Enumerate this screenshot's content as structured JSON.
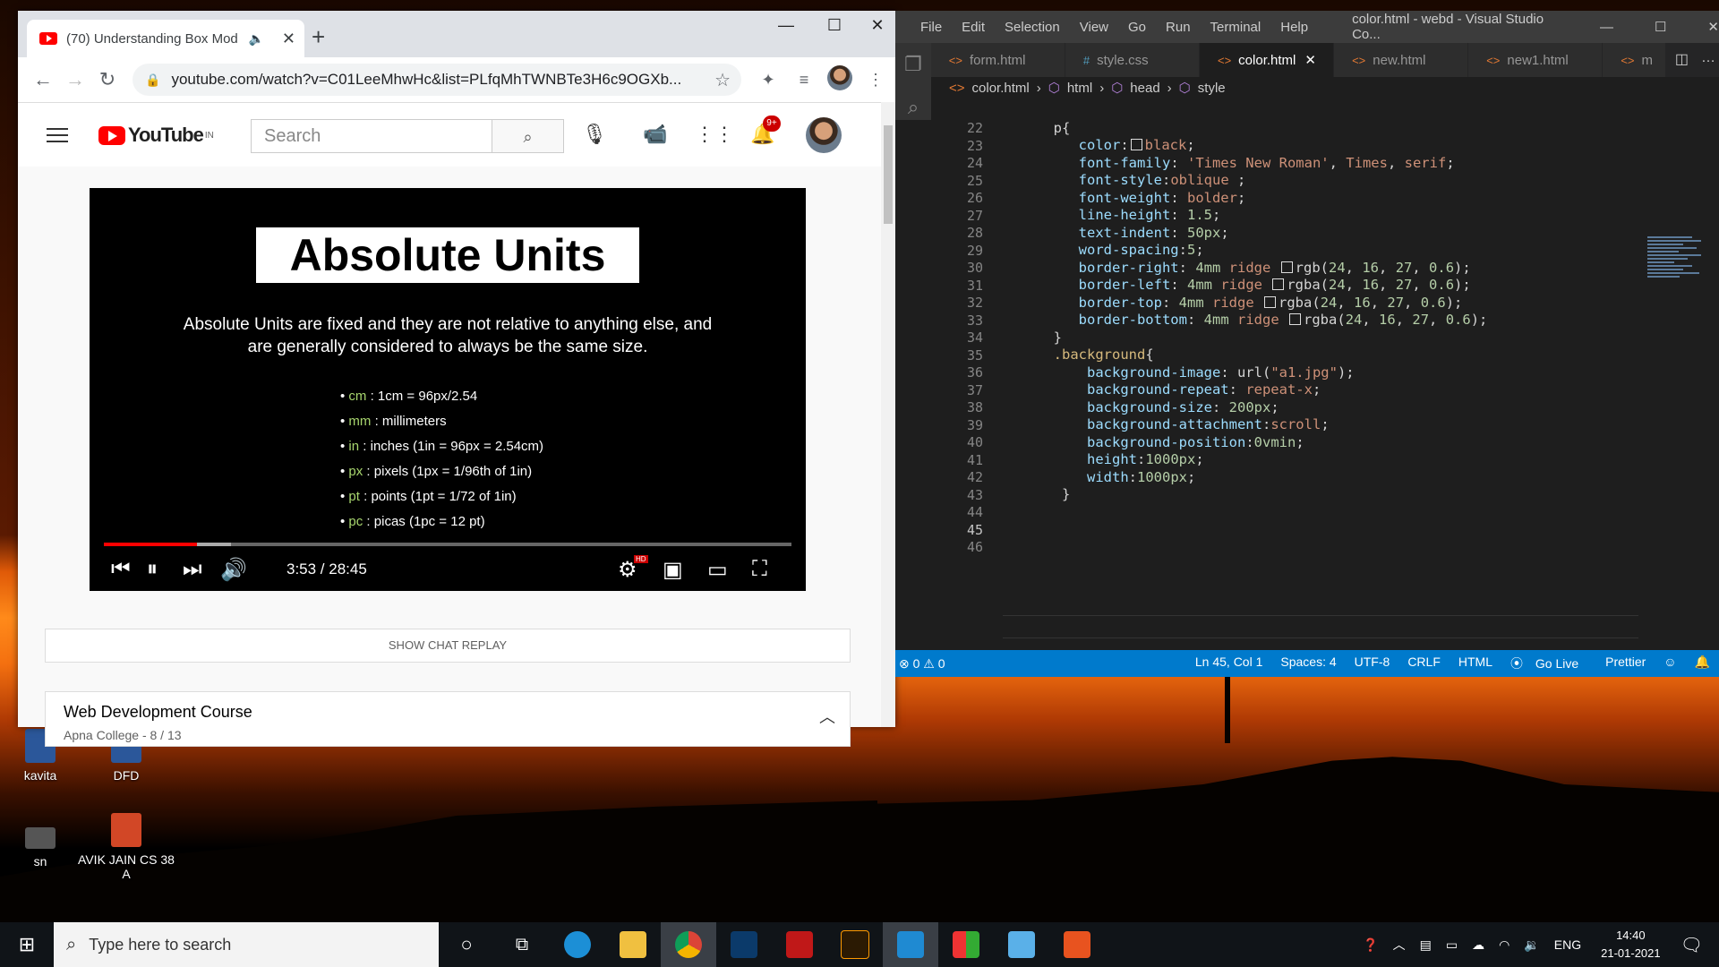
{
  "desktop": {
    "icons": [
      {
        "label": "kavita",
        "type": "word"
      },
      {
        "label": "DFD",
        "type": "word"
      },
      {
        "label": "sn",
        "type": "image"
      },
      {
        "label": "AVIK JAIN CS 38 A",
        "type": "powerpoint"
      }
    ]
  },
  "chrome": {
    "tab_title": "(70) Understanding Box Mod",
    "url": "youtube.com/watch?v=C01LeeMhwHc&list=PLfqMhTWNBTe3H6c9OGXb..."
  },
  "youtube": {
    "logo_text": "YouTube",
    "logo_region": "IN",
    "search_placeholder": "Search",
    "notifications_badge": "9+",
    "slide": {
      "title": "Absolute Units",
      "description": "Absolute Units are fixed and they are not relative to anything else, and are generally considered to always be the same size.",
      "bullets": [
        {
          "key": "cm",
          "text": " : 1cm = 96px/2.54"
        },
        {
          "key": "mm",
          "text": " : millimeters"
        },
        {
          "key": "in",
          "text": " : inches (1in = 96px = 2.54cm)"
        },
        {
          "key": "px",
          "text": " : pixels (1px = 1/96th of 1in)"
        },
        {
          "key": "pt",
          "text": " : points (1pt = 1/72 of 1in)"
        },
        {
          "key": "pc",
          "text": " : picas (1pc = 12 pt)"
        }
      ]
    },
    "player": {
      "time": "3:53 / 28:45",
      "played_fraction": 0.135,
      "buffered_fraction": 0.185,
      "quality_badge": "HD"
    },
    "chat_replay": "SHOW CHAT REPLAY",
    "playlist": {
      "title": "Web Development Course",
      "subtitle": "Apna College - 8 / 13"
    }
  },
  "vscode": {
    "menu": [
      "File",
      "Edit",
      "Selection",
      "View",
      "Go",
      "Run",
      "Terminal",
      "Help"
    ],
    "window_title": "color.html - webd - Visual Studio Co...",
    "tabs": [
      {
        "label": "form.html",
        "icon": "<>"
      },
      {
        "label": "style.css",
        "icon": "#"
      },
      {
        "label": "color.html",
        "icon": "<>"
      },
      {
        "label": "new.html",
        "icon": "<>"
      },
      {
        "label": "new1.html",
        "icon": "<>"
      },
      {
        "label": "m",
        "icon": "<>"
      }
    ],
    "breadcrumb": [
      "color.html",
      "html",
      "head",
      "style"
    ],
    "line_numbers": [
      "22",
      "23",
      "24",
      "25",
      "26",
      "27",
      "28",
      "29",
      "30",
      "31",
      "32",
      "33",
      "34",
      "35",
      "36",
      "37",
      "38",
      "39",
      "40",
      "41",
      "42",
      "43",
      "44",
      "45",
      "46"
    ],
    "status": {
      "problems": "0",
      "warnings": "0",
      "position": "Ln 45, Col 1",
      "spaces": "Spaces: 4",
      "encoding": "UTF-8",
      "eol": "CRLF",
      "language": "HTML",
      "golive": "Go Live",
      "prettier": "Prettier"
    }
  },
  "taskbar": {
    "search_placeholder": "Type here to search",
    "language": "ENG",
    "time": "14:40",
    "date": "21-01-2021"
  },
  "colors": {
    "accent_blue": "#007acc",
    "youtube_red": "#ff0000"
  }
}
